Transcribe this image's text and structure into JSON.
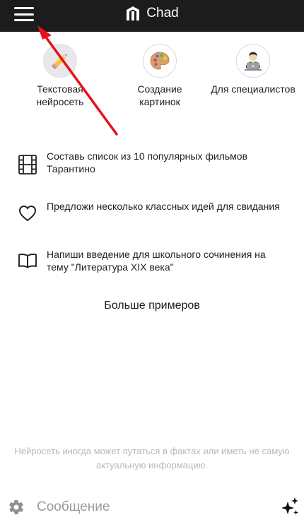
{
  "header": {
    "title": "Chad",
    "menu_icon": "hamburger-menu-icon",
    "logo_icon": "chad-logo-icon"
  },
  "categories": [
    {
      "label": "Текстовая нейросеть",
      "icon": "pencil-icon",
      "active": true
    },
    {
      "label": "Создание картинок",
      "icon": "palette-icon",
      "active": false
    },
    {
      "label": "Для специалистов",
      "icon": "technologist-icon",
      "active": false
    }
  ],
  "examples": [
    {
      "text": "Составь список из 10 популярных фильмов Тарантино",
      "icon": "film-icon"
    },
    {
      "text": "Предложи несколько классных идей для свидания",
      "icon": "heart-icon"
    },
    {
      "text": "Напиши введение для школьного сочинения на тему \"Литература XIX века\"",
      "icon": "book-icon"
    }
  ],
  "more_examples_label": "Больше примеров",
  "disclaimer": "Нейросеть иногда может путаться в фактах или иметь не самую актуальную информацию.",
  "composer": {
    "placeholder": "Сообщение",
    "settings_icon": "gear-icon",
    "send_icon": "sparkle-icon"
  },
  "colors": {
    "header_bg": "#1c1c1c",
    "annotation_arrow": "#e8101a",
    "disclaimer_text": "#b8b8bc"
  }
}
